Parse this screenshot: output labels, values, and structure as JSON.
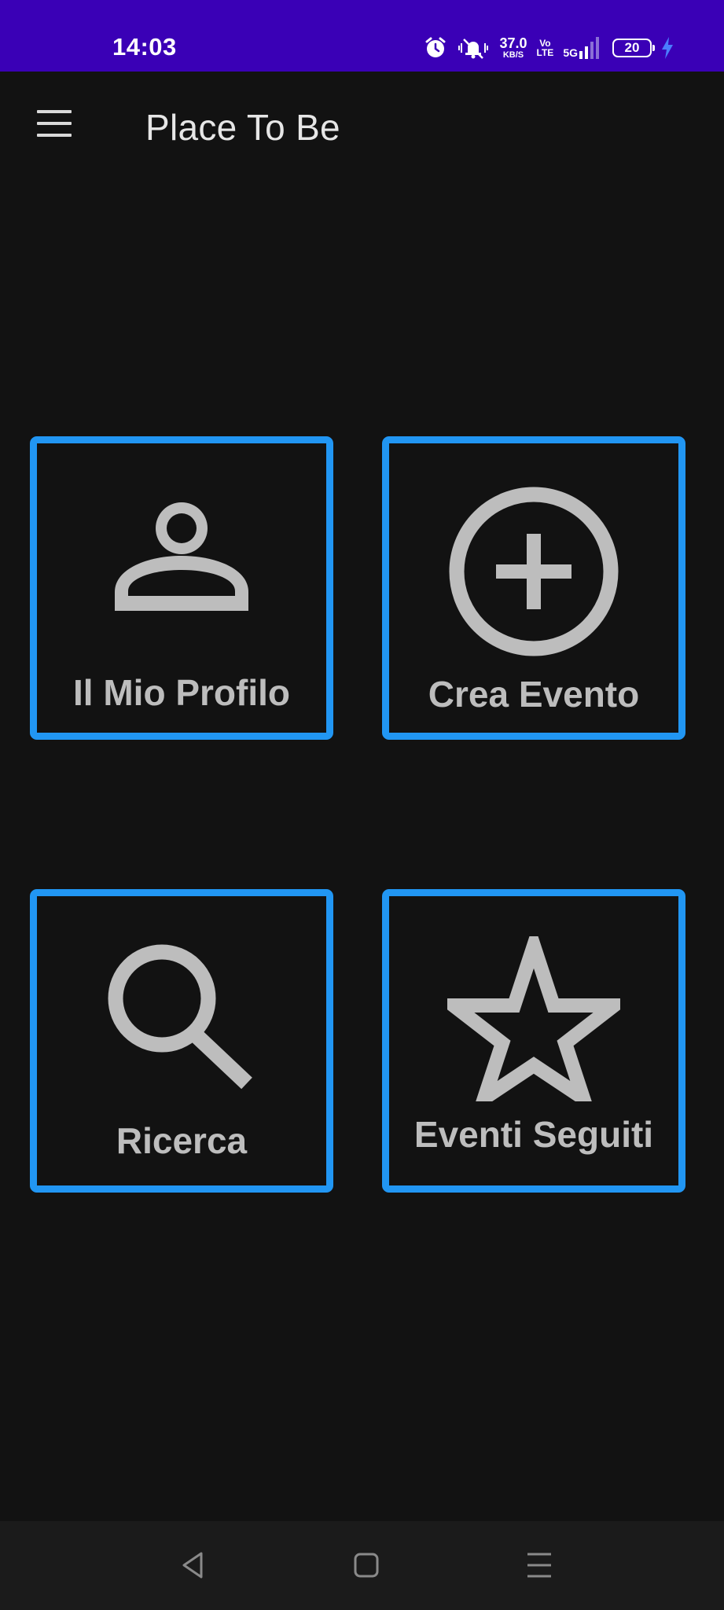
{
  "status_bar": {
    "time": "14:03",
    "speed_value": "37.0",
    "speed_unit": "KB/S",
    "volte_top": "Vo",
    "volte_bottom": "LTE",
    "network": "5G",
    "battery_level": "20",
    "icons": [
      "alarm-icon",
      "mute-vibrate-icon",
      "signal-icon",
      "battery-icon",
      "charging-icon"
    ],
    "background_color": "#3a00b6"
  },
  "app_bar": {
    "title": "Place To Be",
    "menu_icon": "hamburger-menu-icon"
  },
  "tiles": [
    {
      "label": "Il Mio Profilo",
      "icon": "person-icon"
    },
    {
      "label": "Crea Evento",
      "icon": "add-circle-icon"
    },
    {
      "label": "Ricerca",
      "icon": "search-icon"
    },
    {
      "label": "Eventi Seguiti",
      "icon": "star-outline-icon"
    }
  ],
  "nav_bar": {
    "buttons": [
      "back-triangle-icon",
      "home-square-icon",
      "recents-menu-icon"
    ]
  },
  "colors": {
    "accent": "#2196f3",
    "background": "#121212",
    "tile_text": "#bdbdbd",
    "title_text": "#e6e6e6"
  }
}
